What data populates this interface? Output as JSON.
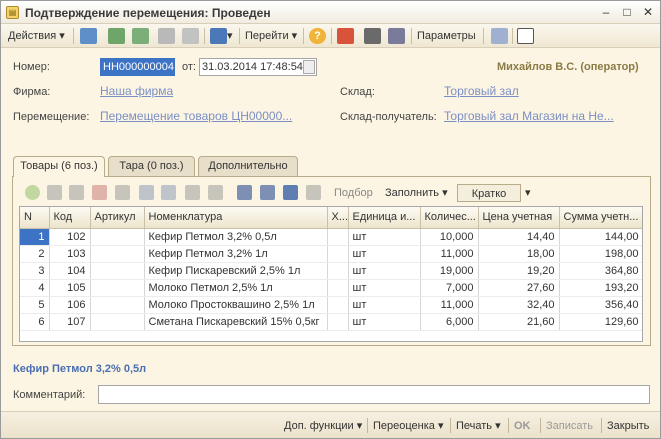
{
  "window": {
    "title": "Подтверждение перемещения: Проведен",
    "minimize": "–",
    "maximize": "□",
    "close": "✕"
  },
  "toolbar": {
    "actions_label": "Действия",
    "goto_label": "Перейти",
    "help_label": "?",
    "params_label": "Параметры"
  },
  "header": {
    "number_label": "Номер:",
    "number_value": "НН000000004",
    "date_label": "от:",
    "date_value": "31.03.2014 17:48:54",
    "user": "Михайлов В.С. (оператор)",
    "firm_label": "Фирма:",
    "firm_value": "Наша фирма",
    "warehouse_label": "Склад:",
    "warehouse_value": "Торговый зал",
    "transfer_label": "Перемещение:",
    "transfer_value": "Перемещение товаров ЦН00000...",
    "dest_label": "Склад-получатель:",
    "dest_value": "Торговый зал Магазин на Не..."
  },
  "tabs": [
    {
      "label": "Товары (6 поз.)",
      "active": true
    },
    {
      "label": "Тара (0 поз.)",
      "active": false
    },
    {
      "label": "Дополнительно",
      "active": false
    }
  ],
  "grid_toolbar": {
    "select_label": "Подбор",
    "fill_label": "Заполнить",
    "view_value": "Кратко"
  },
  "table": {
    "columns": [
      "N",
      "Код",
      "Артикул",
      "Номенклатура",
      "Х...",
      "Единица и...",
      "Количес...",
      "Цена учетная",
      "Сумма учетн..."
    ],
    "rows": [
      [
        "1",
        "102",
        "",
        "Кефир Петмол 3,2% 0,5л",
        "",
        "шт",
        "10,000",
        "14,40",
        "144,00"
      ],
      [
        "2",
        "103",
        "",
        "Кефир Петмол 3,2% 1л",
        "",
        "шт",
        "11,000",
        "18,00",
        "198,00"
      ],
      [
        "3",
        "104",
        "",
        "Кефир Пискаревский 2,5% 1л",
        "",
        "шт",
        "19,000",
        "19,20",
        "364,80"
      ],
      [
        "4",
        "105",
        "",
        "Молоко Петмол 2,5% 1л",
        "",
        "шт",
        "7,000",
        "27,60",
        "193,20"
      ],
      [
        "5",
        "106",
        "",
        "Молоко Простоквашино 2,5% 1л",
        "",
        "шт",
        "11,000",
        "32,40",
        "356,40"
      ],
      [
        "6",
        "107",
        "",
        "Сметана Пискаревский 15% 0,5кг",
        "",
        "шт",
        "6,000",
        "21,60",
        "129,60"
      ]
    ]
  },
  "selected_item": "Кефир Петмол 3,2% 0,5л",
  "comment_label": "Комментарий:",
  "comment_value": "",
  "footer": {
    "extra_label": "Доп. функции",
    "revalue_label": "Переоценка",
    "print_label": "Печать",
    "ok_label": "OK",
    "save_label": "Записать",
    "close_label": "Закрыть"
  }
}
